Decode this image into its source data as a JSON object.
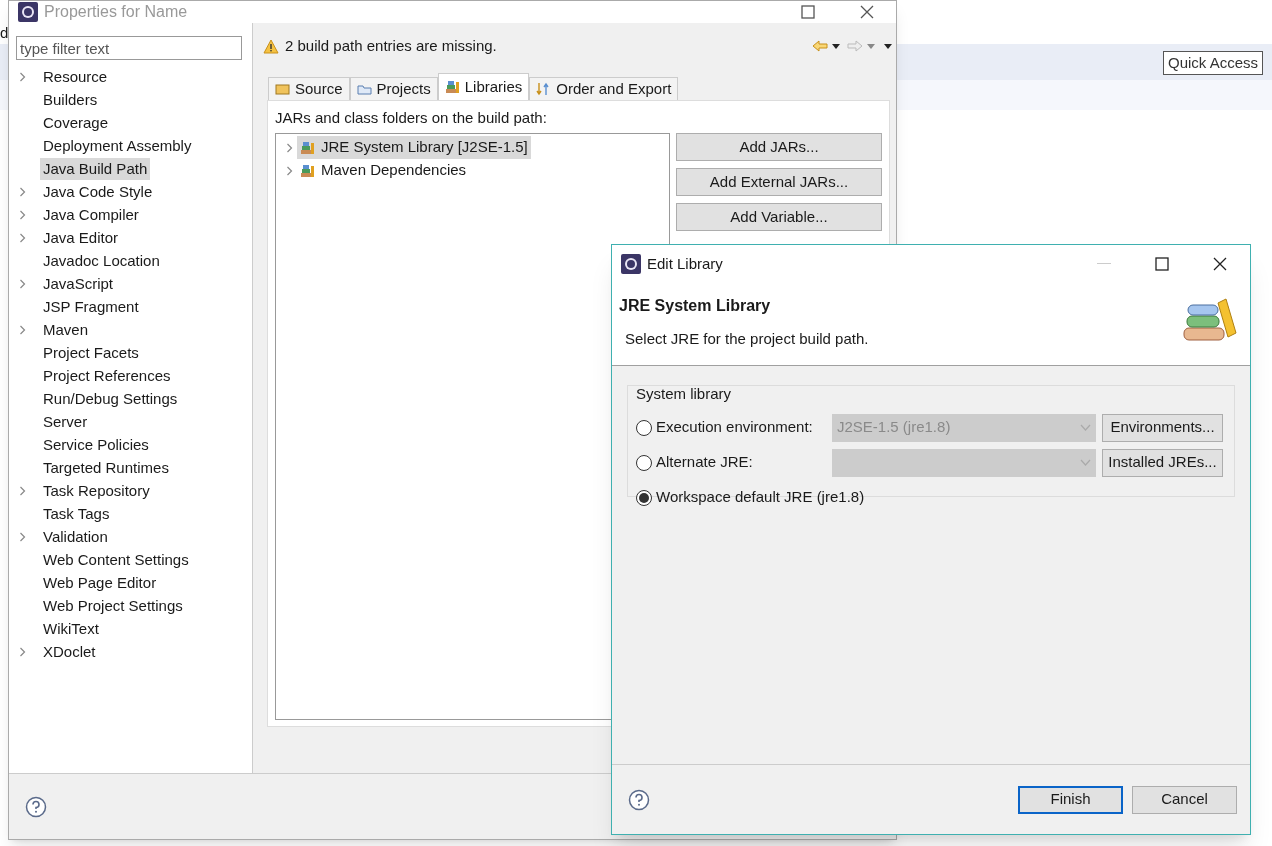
{
  "workbench": {
    "fragment": "d",
    "quick_access": "Quick Access"
  },
  "properties_window": {
    "title": "Properties for Name",
    "filter": {
      "placeholder": "type filter text"
    },
    "nav_items": [
      {
        "label": "Resource",
        "expandable": true,
        "selected": false
      },
      {
        "label": "Builders",
        "expandable": false,
        "selected": false
      },
      {
        "label": "Coverage",
        "expandable": false,
        "selected": false
      },
      {
        "label": "Deployment Assembly",
        "expandable": false,
        "selected": false
      },
      {
        "label": "Java Build Path",
        "expandable": false,
        "selected": true
      },
      {
        "label": "Java Code Style",
        "expandable": true,
        "selected": false
      },
      {
        "label": "Java Compiler",
        "expandable": true,
        "selected": false
      },
      {
        "label": "Java Editor",
        "expandable": true,
        "selected": false
      },
      {
        "label": "Javadoc Location",
        "expandable": false,
        "selected": false
      },
      {
        "label": "JavaScript",
        "expandable": true,
        "selected": false
      },
      {
        "label": "JSP Fragment",
        "expandable": false,
        "selected": false
      },
      {
        "label": "Maven",
        "expandable": true,
        "selected": false
      },
      {
        "label": "Project Facets",
        "expandable": false,
        "selected": false
      },
      {
        "label": "Project References",
        "expandable": false,
        "selected": false
      },
      {
        "label": "Run/Debug Settings",
        "expandable": false,
        "selected": false
      },
      {
        "label": "Server",
        "expandable": false,
        "selected": false
      },
      {
        "label": "Service Policies",
        "expandable": false,
        "selected": false
      },
      {
        "label": "Targeted Runtimes",
        "expandable": false,
        "selected": false
      },
      {
        "label": "Task Repository",
        "expandable": true,
        "selected": false
      },
      {
        "label": "Task Tags",
        "expandable": false,
        "selected": false
      },
      {
        "label": "Validation",
        "expandable": true,
        "selected": false
      },
      {
        "label": "Web Content Settings",
        "expandable": false,
        "selected": false
      },
      {
        "label": "Web Page Editor",
        "expandable": false,
        "selected": false
      },
      {
        "label": "Web Project Settings",
        "expandable": false,
        "selected": false
      },
      {
        "label": "WikiText",
        "expandable": false,
        "selected": false
      },
      {
        "label": "XDoclet",
        "expandable": true,
        "selected": false
      }
    ],
    "message": "2 build path entries are missing.",
    "tabs": [
      {
        "label": "Source",
        "kind": "source",
        "selected": false
      },
      {
        "label": "Projects",
        "kind": "projects",
        "selected": false
      },
      {
        "label": "Libraries",
        "kind": "libraries",
        "selected": true
      },
      {
        "label": "Order and Export",
        "kind": "order",
        "selected": false
      }
    ],
    "section_label": "JARs and class folders on the build path:",
    "entries": [
      {
        "label": "JRE System Library [J2SE-1.5]",
        "selected": true
      },
      {
        "label": "Maven Dependencies",
        "selected": false
      }
    ],
    "buttons": [
      "Add JARs...",
      "Add External JARs...",
      "Add Variable..."
    ]
  },
  "dialog": {
    "title": "Edit Library",
    "heading": "JRE System Library",
    "description": "Select JRE for the project build path.",
    "group_label": "System library",
    "options": [
      {
        "label": "Execution environment:",
        "selected": false,
        "combo": {
          "value": "J2SE-1.5 (jre1.8)",
          "disabled": true
        },
        "button": "Environments..."
      },
      {
        "label": "Alternate JRE:",
        "selected": false,
        "combo": {
          "disabled": true
        },
        "button": "Installed JREs..."
      },
      {
        "label": "Workspace default JRE (jre1.8)",
        "selected": true
      }
    ],
    "buttons": [
      {
        "label": "Finish",
        "default": true
      },
      {
        "label": "Cancel",
        "default": false
      }
    ]
  }
}
